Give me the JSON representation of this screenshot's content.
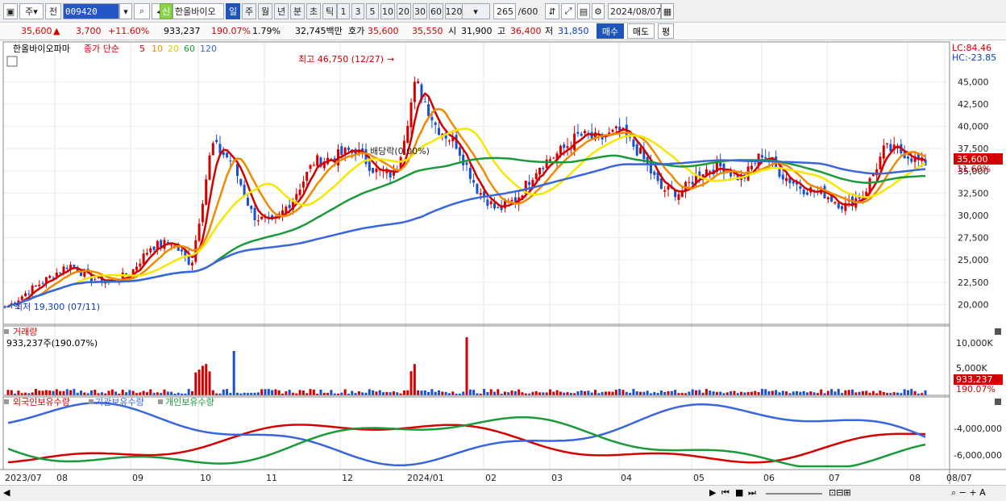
{
  "toolbar": {
    "market": "주",
    "prev_label": "전",
    "code": "009420",
    "new_badge": "신",
    "stock_name": "한올바이오",
    "periods": [
      "일",
      "주",
      "월",
      "년",
      "분",
      "초",
      "틱"
    ],
    "active_period": "일",
    "intervals": [
      "1",
      "3",
      "5",
      "10",
      "20",
      "30",
      "60",
      "120"
    ],
    "count": "265",
    "count_max": "/600",
    "date": "2024/08/07"
  },
  "quote": {
    "price": "35,600",
    "change": "3,700",
    "change_pct": "+11.60%",
    "volume": "933,237",
    "volume_ratio": "190.07%",
    "turnover": "1.79%",
    "amount": "32,745백만",
    "bid_label": "호가",
    "ask": "35,600",
    "bid": "35,550",
    "open_label": "시",
    "open": "31,900",
    "high_label": "고",
    "high": "36,400",
    "low_label": "저",
    "low": "31,850",
    "buy_label": "매수",
    "sell_label": "매도",
    "eval_label": "평"
  },
  "price_panel": {
    "stock": "한올바이오파마",
    "indicator": "종가 단순",
    "ma_periods": [
      "5",
      "10",
      "20",
      "60",
      "120"
    ],
    "lc": "LC:84.46",
    "hc": "HC:-23.85",
    "high_annotation": "최고 46,750 (12/27)",
    "low_annotation": "최저 19,300 (07/11)",
    "dividend": "배당락(0.00%)",
    "current_price": "35,600",
    "current_pct": "11.60%",
    "y_labels": [
      "45,000",
      "42,500",
      "40,000",
      "37,500",
      "35,000",
      "32,500",
      "30,000",
      "27,500",
      "25,000",
      "22,500",
      "20,000"
    ]
  },
  "volume_panel": {
    "title": "거래량",
    "value": "933,237주(190.07%)",
    "y_labels": [
      "10,000K",
      "5,000K"
    ],
    "current": "933,237",
    "current_pct": "190.07%"
  },
  "holdings_panel": {
    "series": [
      "외국인보유수량",
      "기관보유수량",
      "개인보유수량"
    ],
    "y_labels": [
      "-4,000,000",
      "-6,000,000"
    ]
  },
  "x_labels": [
    "2023/07",
    "08",
    "09",
    "10",
    "11",
    "12",
    "2024/01",
    "02",
    "03",
    "04",
    "05",
    "06",
    "07",
    "08",
    "08/07"
  ],
  "colors": {
    "up": "#d40000",
    "down": "#1a4fd0",
    "ma5": "#d40000",
    "ma10": "#f08a00",
    "ma20": "#f7e600",
    "ma60": "#1a9a3a",
    "ma120": "#3a66dd"
  },
  "chart_data": {
    "type": "candlestick",
    "title": "한올바이오파마",
    "ylim": [
      18500,
      46750
    ],
    "high": 46750,
    "low": 19300,
    "last_close": 35600,
    "months": [
      "2023/07",
      "08",
      "09",
      "10",
      "11",
      "12",
      "2024/01",
      "02",
      "03",
      "04",
      "05",
      "06",
      "07",
      "08"
    ],
    "close_path": [
      19800,
      21500,
      23000,
      24500,
      23000,
      22500,
      23500,
      26500,
      27000,
      24500,
      38000,
      36000,
      30000,
      29000,
      32000,
      36000,
      36500,
      37500,
      35000,
      34500,
      45000,
      40000,
      38000,
      33000,
      30500,
      32000,
      35500,
      37000,
      39000,
      38500,
      39500,
      37000,
      33000,
      32500,
      35000,
      35500,
      34000,
      37000,
      34500,
      33000,
      32500,
      31000,
      32500,
      37500,
      37000,
      35600
    ]
  }
}
